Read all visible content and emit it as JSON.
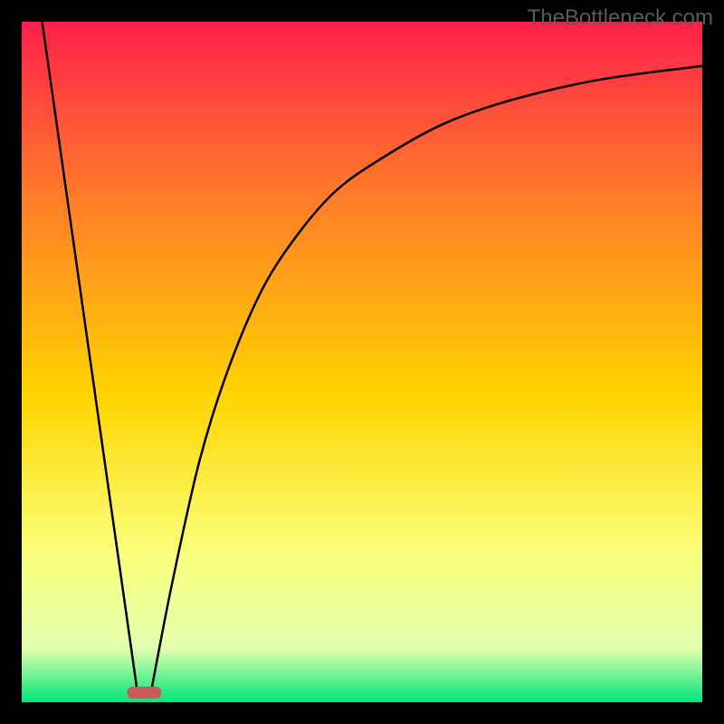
{
  "watermark": "TheBottleneck.com",
  "chart_data": {
    "type": "line",
    "title": "",
    "xlabel": "",
    "ylabel": "",
    "xlim": [
      0,
      100
    ],
    "ylim": [
      0,
      100
    ],
    "background_gradient": {
      "top": "#ff1f4a",
      "upper_mid": "#ff7a2a",
      "mid": "#ffd400",
      "lower_mid": "#faff7a",
      "low": "#e4ffb0",
      "bottom": "#00e67a"
    },
    "marker": {
      "x": 18,
      "y": 1.5,
      "color": "#c85a5a"
    },
    "series": [
      {
        "name": "left-branch",
        "type": "line",
        "color": "#000000",
        "points": [
          {
            "x": 3,
            "y": 100
          },
          {
            "x": 17,
            "y": 1.5
          }
        ]
      },
      {
        "name": "right-branch",
        "type": "line",
        "color": "#000000",
        "points": [
          {
            "x": 19,
            "y": 1.5
          },
          {
            "x": 22,
            "y": 17
          },
          {
            "x": 26,
            "y": 35
          },
          {
            "x": 30,
            "y": 48
          },
          {
            "x": 35,
            "y": 60
          },
          {
            "x": 40,
            "y": 68
          },
          {
            "x": 46,
            "y": 75
          },
          {
            "x": 53,
            "y": 80
          },
          {
            "x": 62,
            "y": 85
          },
          {
            "x": 72,
            "y": 88.5
          },
          {
            "x": 85,
            "y": 91.5
          },
          {
            "x": 100,
            "y": 93.5
          }
        ]
      }
    ]
  }
}
